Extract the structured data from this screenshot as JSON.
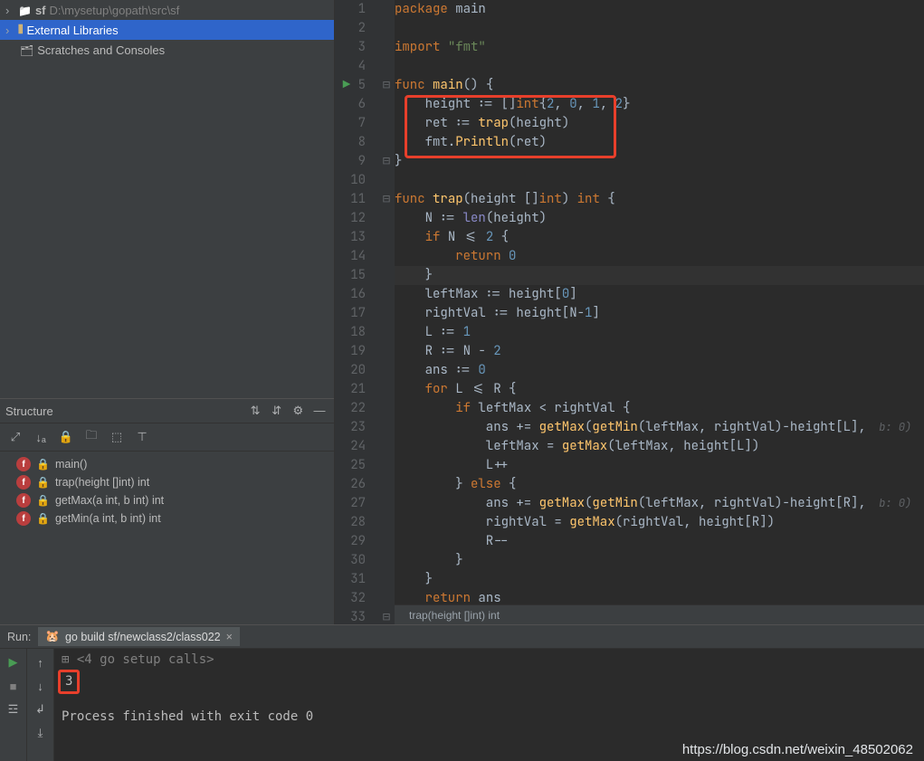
{
  "project": {
    "root": "sf",
    "rootPath": "D:\\mysetup\\gopath\\src\\sf",
    "externalLibs": "External Libraries",
    "scratches": "Scratches and Consoles"
  },
  "structure": {
    "title": "Structure",
    "items": [
      {
        "name": "main()"
      },
      {
        "name": "trap(height []int) int"
      },
      {
        "name": "getMax(a int, b int) int"
      },
      {
        "name": "getMin(a int, b int) int"
      }
    ]
  },
  "editor": {
    "lines": [
      {
        "n": 1,
        "tokens": [
          [
            "kw",
            "package"
          ],
          [
            "id",
            " main"
          ]
        ]
      },
      {
        "n": 2,
        "tokens": []
      },
      {
        "n": 3,
        "tokens": [
          [
            "kw",
            "import"
          ],
          [
            "id",
            " "
          ],
          [
            "str",
            "\"fmt\""
          ]
        ]
      },
      {
        "n": 4,
        "tokens": []
      },
      {
        "n": 5,
        "gutter": "▶",
        "fold": "⊟",
        "tokens": [
          [
            "kw",
            "func"
          ],
          [
            "id",
            " "
          ],
          [
            "fn",
            "main"
          ],
          [
            "id",
            "() {"
          ]
        ]
      },
      {
        "n": 6,
        "tokens": [
          [
            "id",
            "    height := []"
          ],
          [
            "typ",
            "int"
          ],
          [
            "id",
            "{"
          ],
          [
            "num",
            "2"
          ],
          [
            "id",
            ", "
          ],
          [
            "num",
            "0"
          ],
          [
            "id",
            ", "
          ],
          [
            "num",
            "1"
          ],
          [
            "id",
            ", "
          ],
          [
            "num",
            "2"
          ],
          [
            "id",
            "}"
          ]
        ]
      },
      {
        "n": 7,
        "tokens": [
          [
            "id",
            "    ret := "
          ],
          [
            "fn",
            "trap"
          ],
          [
            "id",
            "(height)"
          ]
        ]
      },
      {
        "n": 8,
        "tokens": [
          [
            "id",
            "    fmt."
          ],
          [
            "fn",
            "Println"
          ],
          [
            "id",
            "(ret)"
          ]
        ]
      },
      {
        "n": 9,
        "fold": "⊟",
        "tokens": [
          [
            "id",
            "}"
          ]
        ]
      },
      {
        "n": 10,
        "tokens": []
      },
      {
        "n": 11,
        "fold": "⊟",
        "tokens": [
          [
            "kw",
            "func"
          ],
          [
            "id",
            " "
          ],
          [
            "fn",
            "trap"
          ],
          [
            "id",
            "(height []"
          ],
          [
            "typ",
            "int"
          ],
          [
            "id",
            ") "
          ],
          [
            "typ",
            "int"
          ],
          [
            "id",
            " {"
          ]
        ]
      },
      {
        "n": 12,
        "tokens": [
          [
            "id",
            "    N := "
          ],
          [
            "bfn",
            "len"
          ],
          [
            "id",
            "(height)"
          ]
        ]
      },
      {
        "n": 13,
        "tokens": [
          [
            "id",
            "    "
          ],
          [
            "kw",
            "if"
          ],
          [
            "id",
            " N <= "
          ],
          [
            "num",
            "2"
          ],
          [
            "id",
            " {"
          ]
        ]
      },
      {
        "n": 14,
        "tokens": [
          [
            "id",
            "        "
          ],
          [
            "kw",
            "return"
          ],
          [
            "id",
            " "
          ],
          [
            "num",
            "0"
          ]
        ]
      },
      {
        "n": 15,
        "hl": true,
        "tokens": [
          [
            "id",
            "    }"
          ]
        ]
      },
      {
        "n": 16,
        "tokens": [
          [
            "id",
            "    leftMax := height["
          ],
          [
            "num",
            "0"
          ],
          [
            "id",
            "]"
          ]
        ]
      },
      {
        "n": 17,
        "tokens": [
          [
            "id",
            "    rightVal := height[N-"
          ],
          [
            "num",
            "1"
          ],
          [
            "id",
            "]"
          ]
        ]
      },
      {
        "n": 18,
        "tokens": [
          [
            "id",
            "    L := "
          ],
          [
            "num",
            "1"
          ]
        ]
      },
      {
        "n": 19,
        "tokens": [
          [
            "id",
            "    R := N - "
          ],
          [
            "num",
            "2"
          ]
        ]
      },
      {
        "n": 20,
        "tokens": [
          [
            "id",
            "    ans := "
          ],
          [
            "num",
            "0"
          ]
        ]
      },
      {
        "n": 21,
        "tokens": [
          [
            "id",
            "    "
          ],
          [
            "kw",
            "for"
          ],
          [
            "id",
            " L <= R {"
          ]
        ]
      },
      {
        "n": 22,
        "tokens": [
          [
            "id",
            "        "
          ],
          [
            "kw",
            "if"
          ],
          [
            "id",
            " leftMax < rightVal {"
          ]
        ]
      },
      {
        "n": 23,
        "hint": "  b: 0",
        "tokens": [
          [
            "id",
            "            ans += "
          ],
          [
            "fn",
            "getMax"
          ],
          [
            "id",
            "("
          ],
          [
            "fn",
            "getMin"
          ],
          [
            "id",
            "(leftMax, rightVal)-height[L],"
          ]
        ]
      },
      {
        "n": 24,
        "tokens": [
          [
            "id",
            "            leftMax = "
          ],
          [
            "fn",
            "getMax"
          ],
          [
            "id",
            "(leftMax, height[L])"
          ]
        ]
      },
      {
        "n": 25,
        "tokens": [
          [
            "id",
            "            L++"
          ]
        ]
      },
      {
        "n": 26,
        "tokens": [
          [
            "id",
            "        } "
          ],
          [
            "kw",
            "else"
          ],
          [
            "id",
            " {"
          ]
        ]
      },
      {
        "n": 27,
        "hint": "  b: 0",
        "tokens": [
          [
            "id",
            "            ans += "
          ],
          [
            "fn",
            "getMax"
          ],
          [
            "id",
            "("
          ],
          [
            "fn",
            "getMin"
          ],
          [
            "id",
            "(leftMax, rightVal)-height[R],"
          ]
        ]
      },
      {
        "n": 28,
        "tokens": [
          [
            "id",
            "            rightVal = "
          ],
          [
            "fn",
            "getMax"
          ],
          [
            "id",
            "(rightVal, height[R])"
          ]
        ]
      },
      {
        "n": 29,
        "tokens": [
          [
            "id",
            "            R--"
          ]
        ]
      },
      {
        "n": 30,
        "tokens": [
          [
            "id",
            "        }"
          ]
        ]
      },
      {
        "n": 31,
        "tokens": [
          [
            "id",
            "    }"
          ]
        ]
      },
      {
        "n": 32,
        "tokens": [
          [
            "id",
            "    "
          ],
          [
            "kw",
            "return"
          ],
          [
            "id",
            " ans"
          ]
        ]
      },
      {
        "n": 33,
        "fold": "⊟",
        "tokens": [
          [
            "id",
            "}"
          ]
        ]
      }
    ],
    "breadcrumb": "trap(height []int) int"
  },
  "run": {
    "label": "Run:",
    "tab": "go build sf/newclass2/class022",
    "foldLine": "<4 go setup calls>",
    "output": "3",
    "exitLine": "Process finished with exit code 0"
  },
  "watermark": "https://blog.csdn.net/weixin_48502062"
}
